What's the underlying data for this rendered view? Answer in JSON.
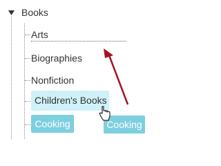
{
  "tree": {
    "root": {
      "label": "Books",
      "icon": "triangle-down-icon"
    },
    "items": [
      {
        "label": "Arts"
      },
      {
        "label": "Biographies"
      },
      {
        "label": "Nonfiction"
      },
      {
        "label": "Children's Books"
      },
      {
        "label": "Cooking"
      }
    ]
  },
  "drag": {
    "ghost_label": "Cooking",
    "cursor_icon": "hand-cursor-icon",
    "arrow_icon": "arrow-icon"
  },
  "colors": {
    "highlight": "#cff1f8",
    "chip": "#7ecfdf",
    "arrow": "#a3131f"
  }
}
